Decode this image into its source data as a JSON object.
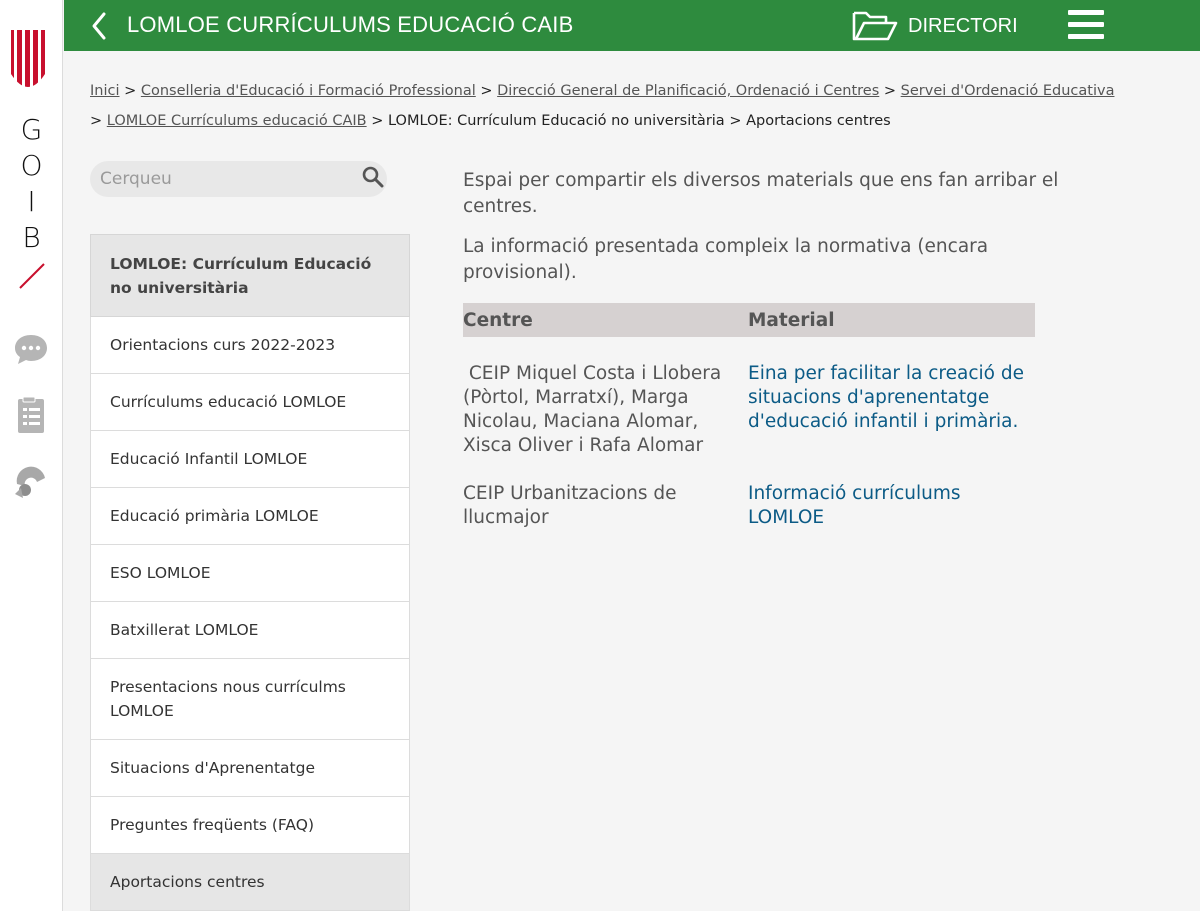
{
  "rail": {
    "letters": [
      "G",
      "O",
      "I",
      "B"
    ],
    "colors": {
      "brand_red": "#c8102e"
    }
  },
  "header": {
    "title": "LOMLOE CURRÍCULUMS EDUCACIÓ CAIB",
    "directori_label": "DIRECTORI",
    "color": "#2e8b3e"
  },
  "breadcrumb": {
    "items": [
      "Inici",
      "Conselleria d'Educació i Formació Professional",
      "Direcció General de Planificació, Ordenació i Centres",
      "Servei d'Ordenació Educativa",
      "LOMLOE Currículums educació CAIB",
      "LOMLOE: Currículum Educació no universitària",
      "Aportacions centres"
    ],
    "separator": ">"
  },
  "search": {
    "placeholder": "Cerqueu"
  },
  "sidenav": {
    "heading": "LOMLOE: Currículum Educació no universitària",
    "items": [
      "Orientacions curs 2022-2023",
      "Currículums educació LOMLOE",
      "Educació Infantil LOMLOE",
      "Educació primària LOMLOE",
      "ESO LOMLOE",
      "Batxillerat LOMLOE",
      "Presentacions nous currículms LOMLOE",
      "Situacions d'Aprenentatge",
      "Preguntes freqüents (FAQ)",
      "Aportacions centres"
    ],
    "active": "Aportacions centres"
  },
  "content": {
    "para1": "Espai per compartir els diversos materials que ens fan arribar el centres.",
    "para2": "La informació presentada compleix la normativa (encara provisional).",
    "table": {
      "headers": [
        "Centre",
        "Material"
      ],
      "rows": [
        {
          "centre": " CEIP Miquel Costa i Llobera (Pòrtol, Marratxí), Marga Nicolau, Maciana Alomar, Xisca Oliver i Rafa Alomar",
          "material": "Eina per facilitar la creació de situacions d'aprenentatge d'educació infantil i primària."
        },
        {
          "centre": "CEIP Urbanitzacions de llucmajor",
          "material": "Informació currículums LOMLOE"
        }
      ]
    },
    "link_color": "#0c5b86"
  }
}
